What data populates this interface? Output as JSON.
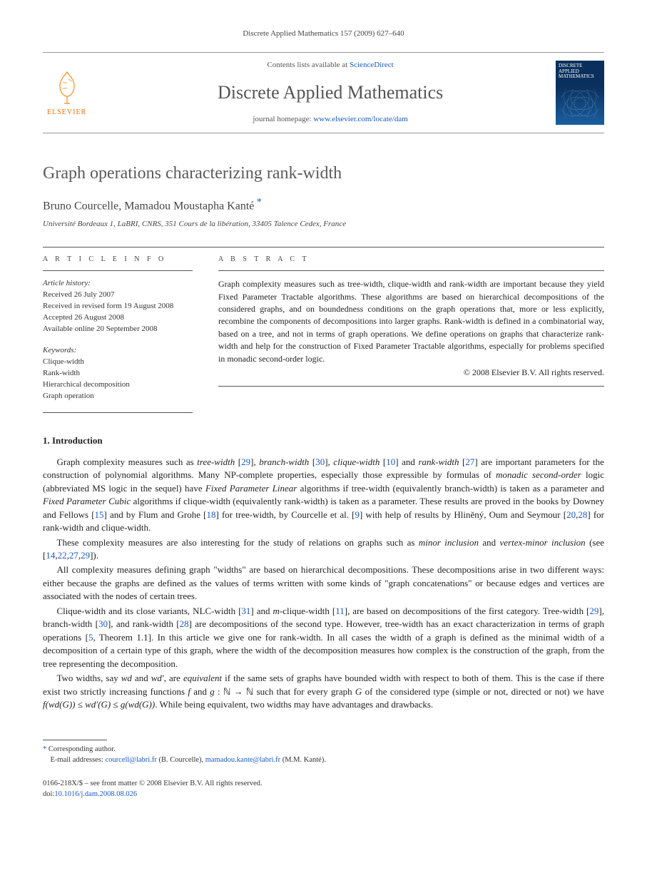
{
  "header": {
    "citation": "Discrete Applied Mathematics 157 (2009) 627–640"
  },
  "banner": {
    "publisher": "ELSEVIER",
    "contents_prefix": "Contents lists available at ",
    "contents_link": "ScienceDirect",
    "journal_title": "Discrete Applied Mathematics",
    "homepage_prefix": "journal homepage: ",
    "homepage_url": "www.elsevier.com/locate/dam",
    "cover_text": "DISCRETE APPLIED MATHEMATICS"
  },
  "article": {
    "title": "Graph operations characterizing rank-width",
    "authors": "Bruno Courcelle, Mamadou Moustapha Kanté",
    "affiliation": "Université Bordeaux 1, LaBRI, CNRS, 351 Cours de la libération, 33405 Talence Cedex, France"
  },
  "info": {
    "label": "A R T I C L E   I N F O",
    "history_head": "Article history:",
    "history": [
      "Received 26 July 2007",
      "Received in revised form 19 August 2008",
      "Accepted 26 August 2008",
      "Available online 20 September 2008"
    ],
    "keywords_head": "Keywords:",
    "keywords": [
      "Clique-width",
      "Rank-width",
      "Hierarchical decomposition",
      "Graph operation"
    ]
  },
  "abstract": {
    "label": "A B S T R A C T",
    "text": "Graph complexity measures such as tree-width, clique-width and rank-width are important because they yield Fixed Parameter Tractable algorithms. These algorithms are based on hierarchical decompositions of the considered graphs, and on boundedness conditions on the graph operations that, more or less explicitly, recombine the components of decompositions into larger graphs. Rank-width is defined in a combinatorial way, based on a tree, and not in terms of graph operations. We define operations on graphs that characterize rank-width and help for the construction of Fixed Parameter Tractable algorithms, especially for problems specified in monadic second-order logic.",
    "copyright": "© 2008 Elsevier B.V. All rights reserved."
  },
  "sections": {
    "s1": {
      "heading": "1. Introduction",
      "p1_a": "Graph complexity measures such as ",
      "p1_tw": "tree-width",
      "p1_b": " [",
      "p1_r1": "29",
      "p1_c": "], ",
      "p1_bw": "branch-width",
      "p1_d": " [",
      "p1_r2": "30",
      "p1_e": "], ",
      "p1_cw": "clique-width",
      "p1_f": " [",
      "p1_r3": "10",
      "p1_g": "] and ",
      "p1_rw": "rank-width",
      "p1_h": " [",
      "p1_r4": "27",
      "p1_i": "] are important parameters for the construction of polynomial algorithms. Many NP-complete properties, especially those expressible by formulas of ",
      "p1_mso": "monadic second-order",
      "p1_j": " logic (abbreviated MS logic in the sequel) have ",
      "p1_fpl": "Fixed Parameter Linear",
      "p1_k": " algorithms if tree-width (equivalently branch-width) is taken as a parameter and ",
      "p1_fpc": "Fixed Parameter Cubic",
      "p1_l": " algorithms if clique-width (equivalently rank-width) is taken as a parameter. These results are proved in the books by Downey and Fellows [",
      "p1_r5": "15",
      "p1_m": "] and by Flum and Grohe [",
      "p1_r6": "18",
      "p1_n": "] for tree-width, by Courcelle et al. [",
      "p1_r7": "9",
      "p1_o": "] with help of results by Hliněný, Oum and Seymour [",
      "p1_r8": "20",
      "p1_p": ",",
      "p1_r9": "28",
      "p1_q": "] for rank-width and clique-width.",
      "p2_a": "These complexity measures are also interesting for the study of relations on graphs such as ",
      "p2_mi": "minor inclusion",
      "p2_b": " and ",
      "p2_vmi": "vertex-minor inclusion",
      "p2_c": " (see [",
      "p2_r1": "14",
      "p2_d": ",",
      "p2_r2": "22",
      "p2_e": ",",
      "p2_r3": "27",
      "p2_f": ",",
      "p2_r4": "29",
      "p2_g": "]).",
      "p3": "All complexity measures defining graph \"widths\" are based on hierarchical decompositions. These decompositions arise in two different ways: either because the graphs are defined as the values of terms written with some kinds of \"graph concatenations\" or because edges and vertices are associated with the nodes of certain trees.",
      "p4_a": "Clique-width and its close variants, NLC-width [",
      "p4_r1": "31",
      "p4_b": "] and ",
      "p4_mcw": "m",
      "p4_c": "-clique-width [",
      "p4_r2": "11",
      "p4_d": "], are based on decompositions of the first category. Tree-width [",
      "p4_r3": "29",
      "p4_e": "], branch-width [",
      "p4_r4": "30",
      "p4_f": "], and rank-width [",
      "p4_r5": "28",
      "p4_g": "] are decompositions of the second type. However, tree-width has an exact characterization in terms of graph operations [",
      "p4_r6": "5",
      "p4_h": ", Theorem 1.1]. In this article we give one for rank-width. In all cases the width of a graph is defined as the minimal width of a decomposition of a certain type of this graph, where the width of the decomposition measures how complex is the construction of the graph, from the tree representing the decomposition.",
      "p5_a": "Two widths, say ",
      "p5_wd": "wd",
      "p5_b": " and ",
      "p5_wdp": "wd′",
      "p5_c": ", are ",
      "p5_eq": "equivalent",
      "p5_d": " if the same sets of graphs have bounded width with respect to both of them. This is the case if there exist two strictly increasing functions ",
      "p5_f": "f",
      "p5_e": " and ",
      "p5_g": "g",
      "p5_e2": " : ℕ → ℕ such that for every graph ",
      "p5_G": "G",
      "p5_e3": " of the considered type (simple or not, directed or not) we have ",
      "p5_ineq": "f(wd(G)) ≤ wd′(G) ≤ g(wd(G))",
      "p5_e4": ". While being equivalent, two widths may have advantages and drawbacks."
    }
  },
  "footnotes": {
    "corr_label": "Corresponding author.",
    "email_label": "E-mail addresses:",
    "email1": "courcell@labri.fr",
    "email1_who": " (B. Courcelle), ",
    "email2": "mamadou.kante@labri.fr",
    "email2_who": " (M.M. Kanté)."
  },
  "footer": {
    "line1": "0166-218X/$ – see front matter © 2008 Elsevier B.V. All rights reserved.",
    "doi_label": "doi:",
    "doi": "10.1016/j.dam.2008.08.026"
  }
}
